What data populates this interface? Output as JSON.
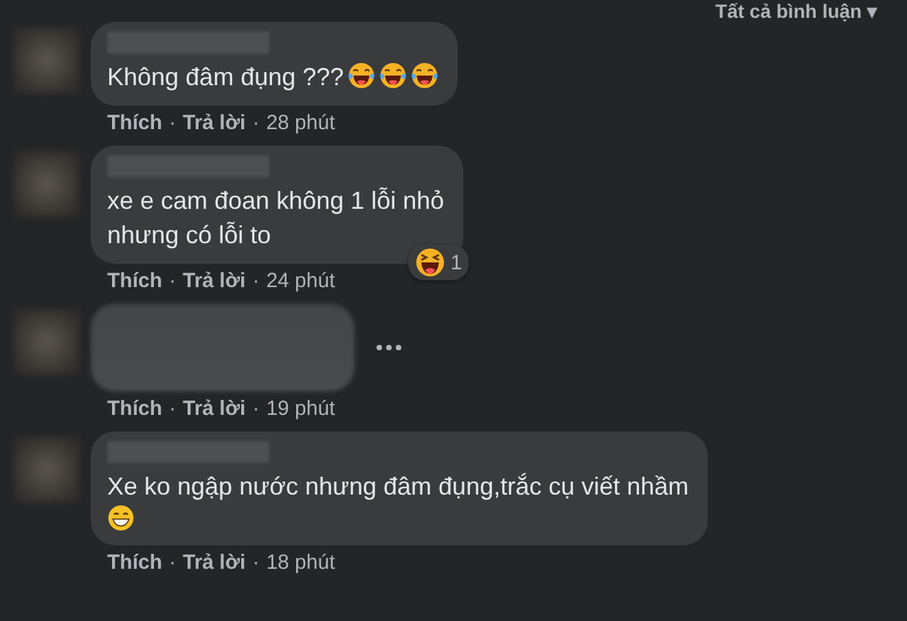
{
  "sort_menu": {
    "label": "Tất cả bình luận",
    "caret": "▾"
  },
  "comments": [
    {
      "kind": "text",
      "text": "Không đâm đụng ???",
      "emojis": [
        {
          "kind": "tears"
        },
        {
          "kind": "tears"
        },
        {
          "kind": "tears"
        }
      ],
      "menu_shown": false,
      "actions": [
        {
          "kind": "link",
          "label": "Thích"
        },
        {
          "kind": "sep",
          "label": "·"
        },
        {
          "kind": "link",
          "label": "Trả lời"
        },
        {
          "kind": "sep",
          "label": "·"
        },
        {
          "kind": "time",
          "label": "28 phút"
        }
      ]
    },
    {
      "kind": "text",
      "text": "xe e cam đoan không 1 lỗi nhỏ\nnhưng có lỗi to",
      "menu_shown": false,
      "reaction": {
        "kind": "laugh",
        "count": "1"
      },
      "actions": [
        {
          "kind": "link",
          "label": "Thích"
        },
        {
          "kind": "sep",
          "label": "·"
        },
        {
          "kind": "link",
          "label": "Trả lời"
        },
        {
          "kind": "sep",
          "label": "·"
        },
        {
          "kind": "time",
          "label": "24 phút"
        }
      ]
    },
    {
      "kind": "blurred",
      "menu_shown": true,
      "actions": [
        {
          "kind": "link",
          "label": "Thích"
        },
        {
          "kind": "sep",
          "label": "·"
        },
        {
          "kind": "link",
          "label": "Trả lời"
        },
        {
          "kind": "sep",
          "label": "·"
        },
        {
          "kind": "time",
          "label": "19 phút"
        }
      ]
    },
    {
      "kind": "text",
      "text": "Xe ko ngập nước nhưng đâm đụng,trắc cụ viết nhầm",
      "emoji_line": [
        {
          "kind": "grin"
        }
      ],
      "menu_shown": false,
      "actions": [
        {
          "kind": "link",
          "label": "Thích"
        },
        {
          "kind": "sep",
          "label": "·"
        },
        {
          "kind": "link",
          "label": "Trả lời"
        },
        {
          "kind": "sep",
          "label": "·"
        },
        {
          "kind": "time",
          "label": "18 phút"
        }
      ]
    }
  ]
}
